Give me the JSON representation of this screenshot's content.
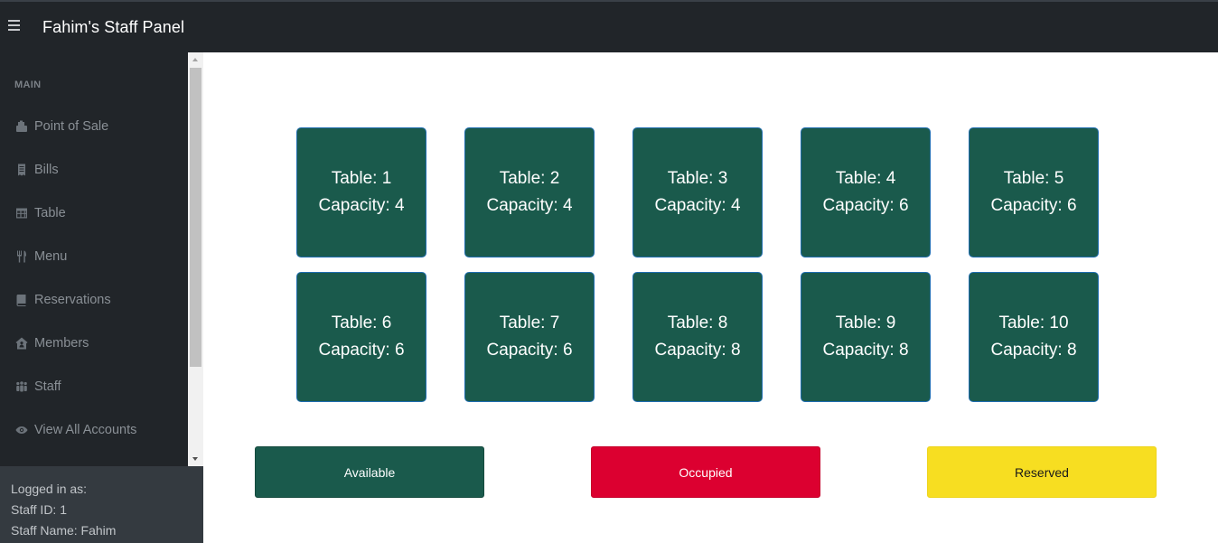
{
  "header": {
    "brand": "Fahim's Staff Panel",
    "toggle_icon": "hamburger-menu-icon"
  },
  "sidebar": {
    "section_heading": "MAIN",
    "items": [
      {
        "label": "Point of Sale",
        "icon": "cash-register-icon"
      },
      {
        "label": "Bills",
        "icon": "receipt-icon"
      },
      {
        "label": "Table",
        "icon": "table-grid-icon"
      },
      {
        "label": "Menu",
        "icon": "utensils-icon"
      },
      {
        "label": "Reservations",
        "icon": "book-icon"
      },
      {
        "label": "Members",
        "icon": "house-user-icon"
      },
      {
        "label": "Staff",
        "icon": "people-group-icon"
      },
      {
        "label": "View All Accounts",
        "icon": "eye-icon"
      }
    ],
    "footer": {
      "logged_in_label": "Logged in as:",
      "staff_id": "Staff ID: 1",
      "staff_name": "Staff Name: Fahim"
    }
  },
  "tables": [
    {
      "table": "Table: 1",
      "capacity": "Capacity: 4"
    },
    {
      "table": "Table: 2",
      "capacity": "Capacity: 4"
    },
    {
      "table": "Table: 3",
      "capacity": "Capacity: 4"
    },
    {
      "table": "Table: 4",
      "capacity": "Capacity: 6"
    },
    {
      "table": "Table: 5",
      "capacity": "Capacity: 6"
    },
    {
      "table": "Table: 6",
      "capacity": "Capacity: 6"
    },
    {
      "table": "Table: 7",
      "capacity": "Capacity: 6"
    },
    {
      "table": "Table: 8",
      "capacity": "Capacity: 8"
    },
    {
      "table": "Table: 9",
      "capacity": "Capacity: 8"
    },
    {
      "table": "Table: 10",
      "capacity": "Capacity: 8"
    }
  ],
  "legend": {
    "available": "Available",
    "occupied": "Occupied",
    "reserved": "Reserved"
  },
  "colors": {
    "available": "#1a5a4c",
    "occupied": "#dc0030",
    "reserved": "#f7de21",
    "sidebar_bg": "#212529",
    "footer_bg": "#343a40"
  }
}
